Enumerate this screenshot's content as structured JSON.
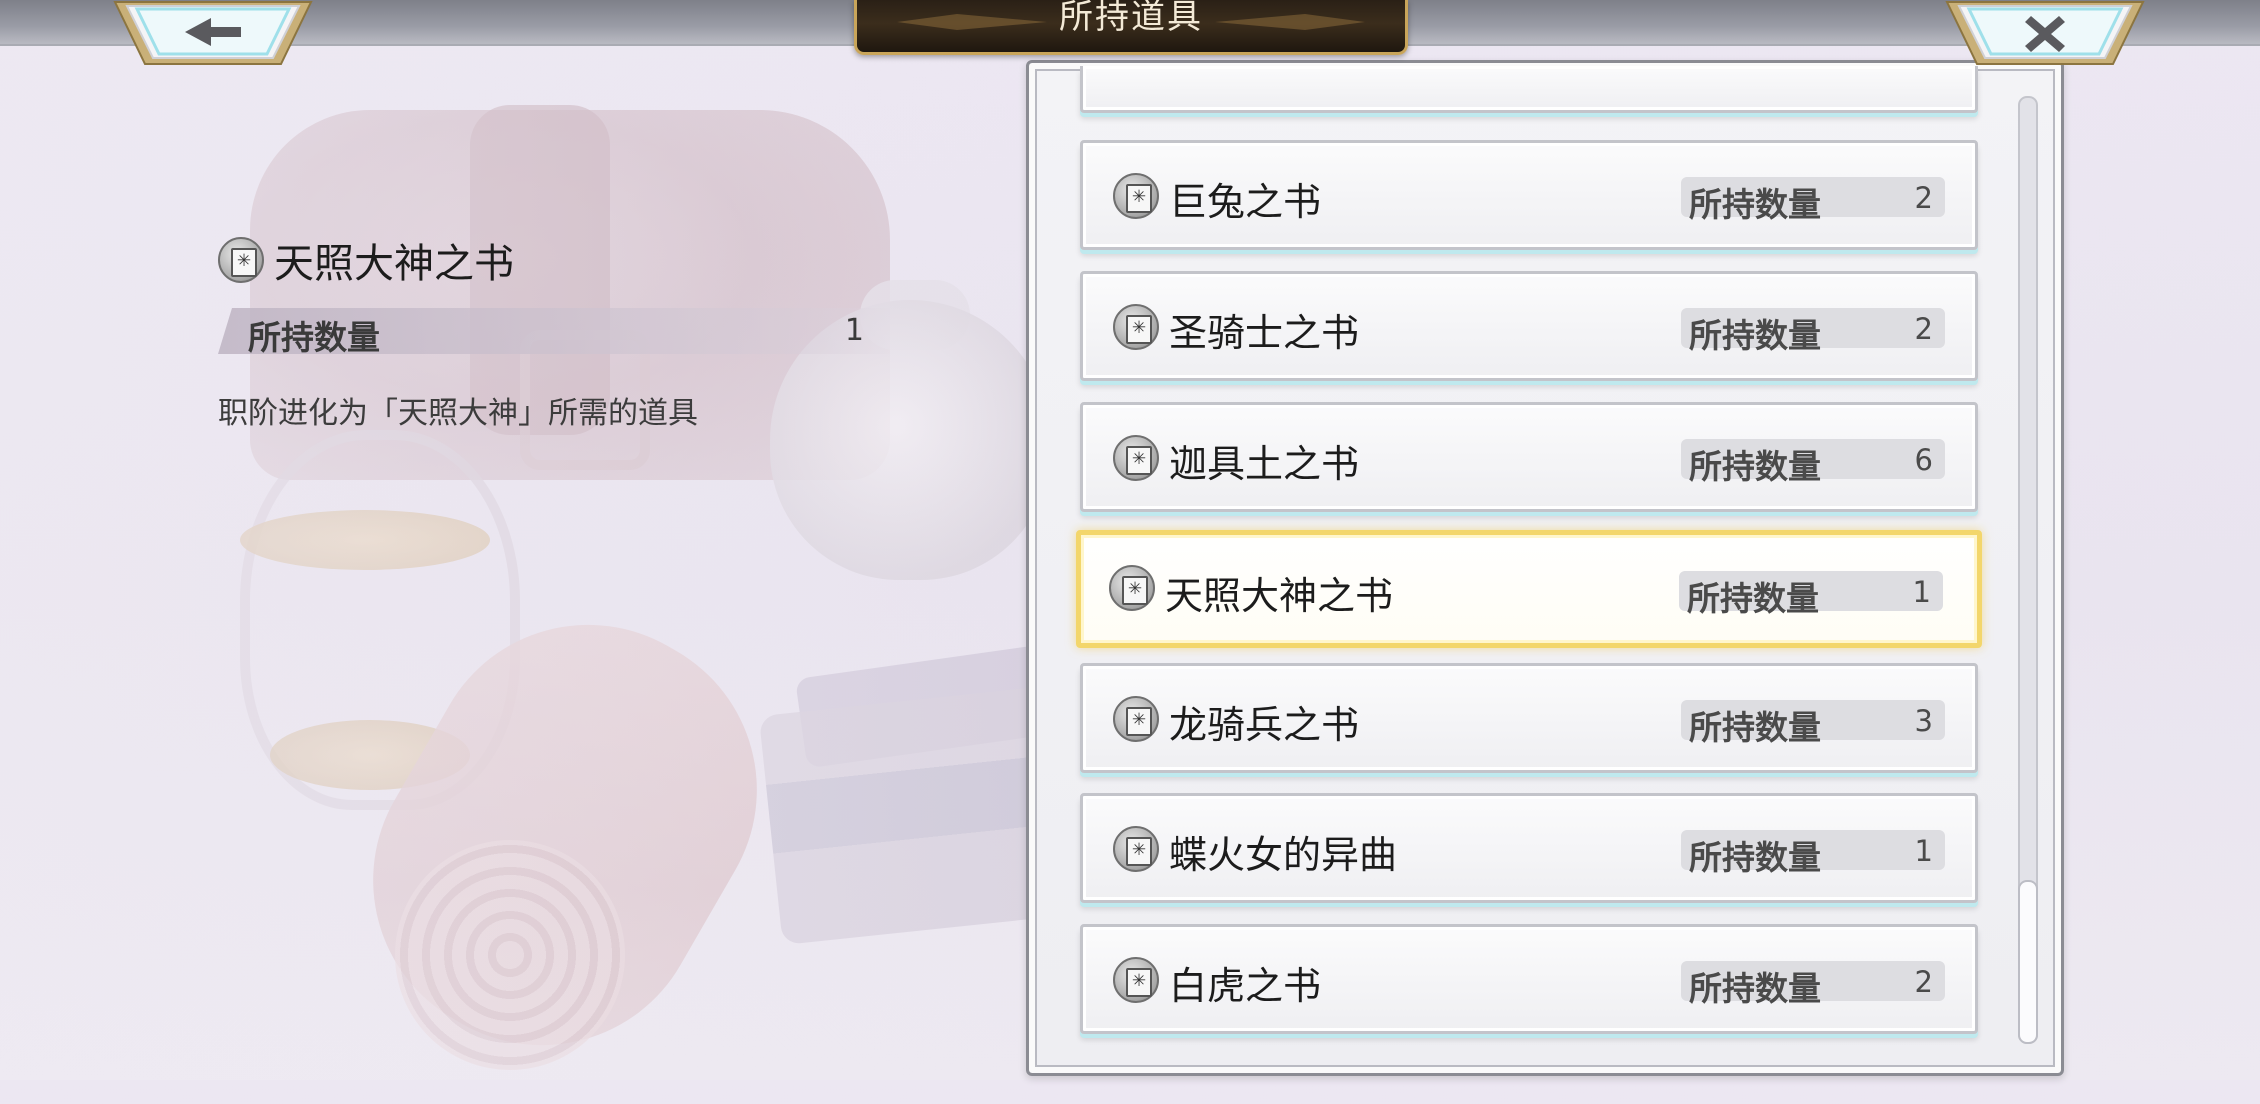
{
  "header": {
    "title": "所持道具",
    "back_icon": "arrow-left-icon",
    "close_icon": "close-icon"
  },
  "detail": {
    "icon": "book-icon",
    "name": "天照大神之书",
    "qty_label": "所持数量",
    "qty_value": "1",
    "description": "职阶进化为「天照大神」所需的道具"
  },
  "list": {
    "items": [
      {
        "name": "巨兔之书",
        "qty_label": "所持数量",
        "qty": "2",
        "selected": false
      },
      {
        "name": "圣骑士之书",
        "qty_label": "所持数量",
        "qty": "2",
        "selected": false
      },
      {
        "name": "迦具土之书",
        "qty_label": "所持数量",
        "qty": "6",
        "selected": false
      },
      {
        "name": "天照大神之书",
        "qty_label": "所持数量",
        "qty": "1",
        "selected": true
      },
      {
        "name": "龙骑兵之书",
        "qty_label": "所持数量",
        "qty": "3",
        "selected": false
      },
      {
        "name": "蝶火女的异曲",
        "qty_label": "所持数量",
        "qty": "1",
        "selected": false
      },
      {
        "name": "白虎之书",
        "qty_label": "所持数量",
        "qty": "2",
        "selected": false
      }
    ]
  },
  "colors": {
    "selected_border": "#f3d66b",
    "title_plate": "#2a2016",
    "gold_trim": "#c9a55a"
  }
}
